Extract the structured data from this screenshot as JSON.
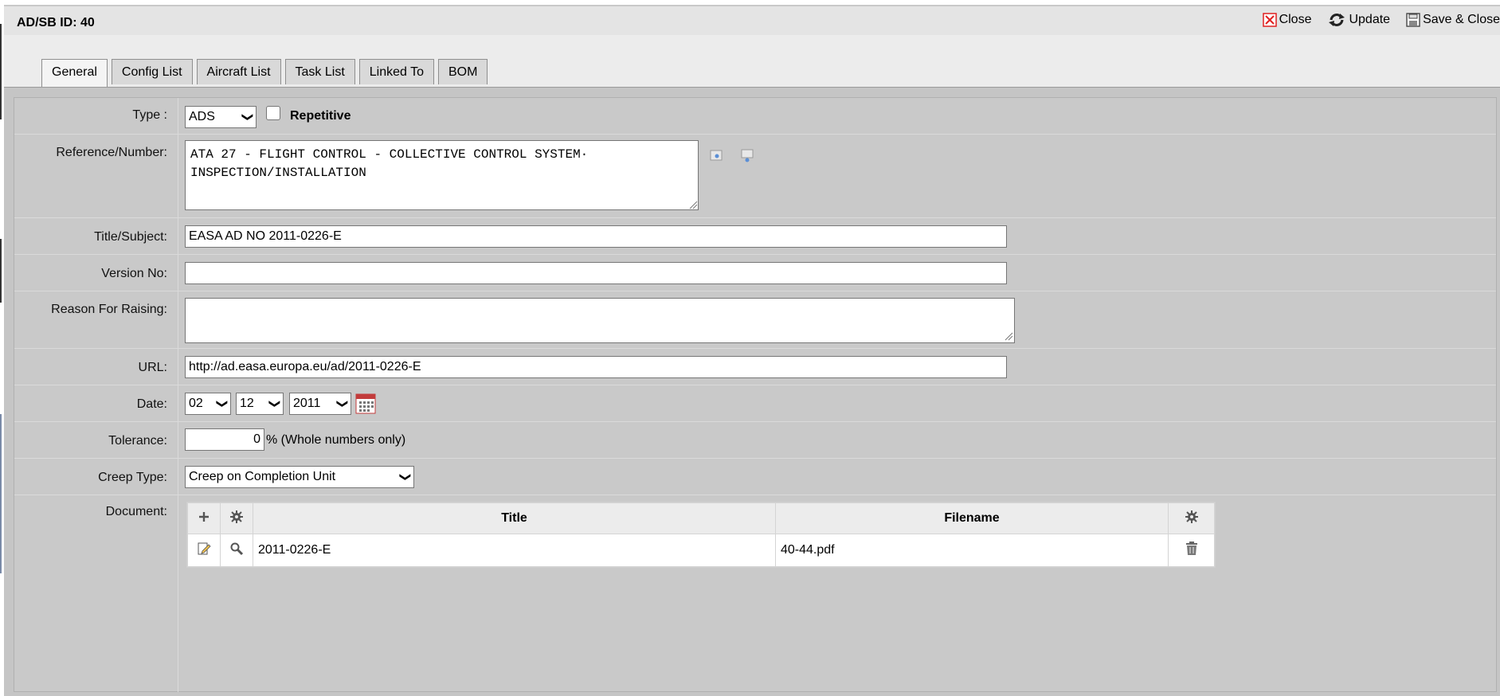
{
  "header": {
    "title": "AD/SB ID: 40",
    "actions": {
      "close": "Close",
      "update": "Update",
      "save_close": "Save & Close"
    }
  },
  "tabs": [
    "General",
    "Config List",
    "Aircraft List",
    "Task List",
    "Linked To",
    "BOM"
  ],
  "form": {
    "type": {
      "label": "Type :",
      "value": "ADS",
      "repetitive_label": "Repetitive",
      "repetitive_checked": false
    },
    "reference": {
      "label": "Reference/Number:",
      "value": "ATA 27 - FLIGHT CONTROL - COLLECTIVE CONTROL SYSTEM·\nINSPECTION/INSTALLATION"
    },
    "title": {
      "label": "Title/Subject:",
      "value": "EASA AD NO 2011-0226-E"
    },
    "version": {
      "label": "Version No:",
      "value": ""
    },
    "reason": {
      "label": "Reason For Raising:",
      "value": ""
    },
    "url": {
      "label": "URL:",
      "value": "http://ad.easa.europa.eu/ad/2011-0226-E"
    },
    "date": {
      "label": "Date:",
      "day": "02",
      "month": "12",
      "year": "2011"
    },
    "tolerance": {
      "label": "Tolerance:",
      "value": "0",
      "suffix": "% (Whole numbers only)"
    },
    "creep": {
      "label": "Creep Type:",
      "value": "Creep on Completion Unit"
    },
    "document": {
      "label": "Document:",
      "columns": {
        "title": "Title",
        "filename": "Filename"
      },
      "rows": [
        {
          "title": "2011-0226-E",
          "filename": "40-44.pdf"
        }
      ]
    }
  },
  "colors": {
    "close_icon": "#e02020",
    "calendar_icon": "#c23b3b",
    "panel_bg": "#c9c9c9"
  },
  "icons": [
    "close-icon",
    "update-icon",
    "save-icon",
    "lookup-icon",
    "clear-icon",
    "calendar-icon",
    "add-icon",
    "gear-icon",
    "edit-icon",
    "search-icon",
    "trash-icon"
  ]
}
